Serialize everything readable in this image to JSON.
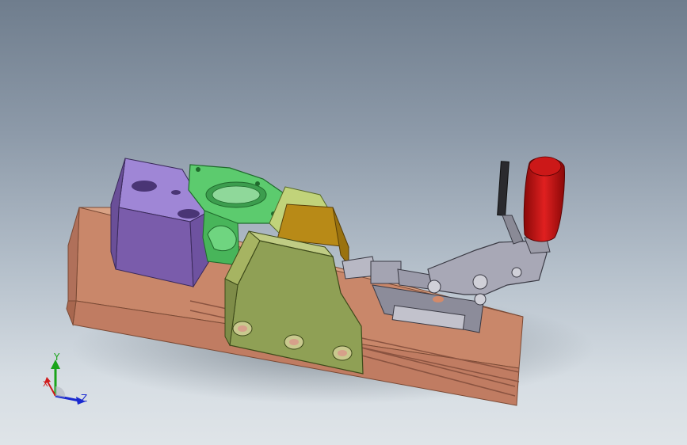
{
  "viewport": {
    "background_top": "#6f7d8d",
    "background_bottom": "#dfe4e8"
  },
  "model": {
    "parts": [
      {
        "name": "base-rail",
        "color": "#c9876a"
      },
      {
        "name": "purple-block",
        "color": "#8a6fb5"
      },
      {
        "name": "green-flange",
        "color": "#58c46a"
      },
      {
        "name": "yellow-bracket",
        "color": "#9aa860"
      },
      {
        "name": "gold-wedge",
        "color": "#b88a17"
      },
      {
        "name": "toggle-clamp",
        "color": "#9c9ca8"
      },
      {
        "name": "red-handle",
        "color": "#c41414"
      }
    ]
  },
  "triad": {
    "x_label": "X",
    "y_label": "Y",
    "z_label": "Z",
    "x_color": "#d01a1a",
    "y_color": "#1aa41a",
    "z_color": "#1a2ad0"
  }
}
